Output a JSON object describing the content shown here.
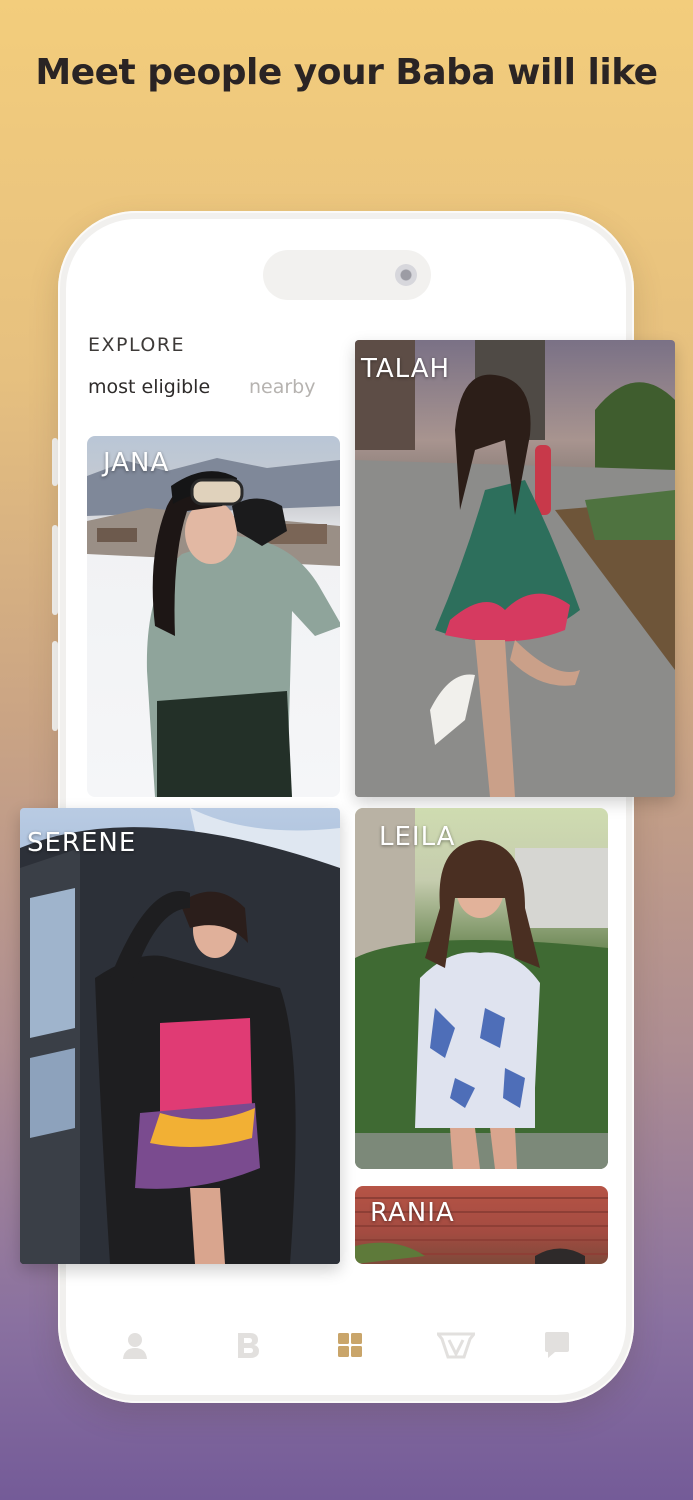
{
  "headline": "Meet people your Baba will like",
  "explore": {
    "title": "EXPLORE",
    "tabs": [
      {
        "label": "most eligible",
        "active": true
      },
      {
        "label": "nearby",
        "active": false
      }
    ]
  },
  "profiles": [
    {
      "name": "JANA"
    },
    {
      "name": "TALAH"
    },
    {
      "name": "SERENE"
    },
    {
      "name": "LEILA"
    },
    {
      "name": "RANIA"
    }
  ],
  "bottom_nav": [
    {
      "icon": "profile-icon",
      "active": false
    },
    {
      "icon": "baba-b-icon",
      "active": false
    },
    {
      "icon": "grid-icon",
      "active": true
    },
    {
      "icon": "shield-emblem-icon",
      "active": false
    },
    {
      "icon": "chat-icon",
      "active": false
    }
  ],
  "colors": {
    "nav_active": "#c9a56a",
    "nav_inactive": "#e2e0de",
    "headline": "#2a2424"
  }
}
